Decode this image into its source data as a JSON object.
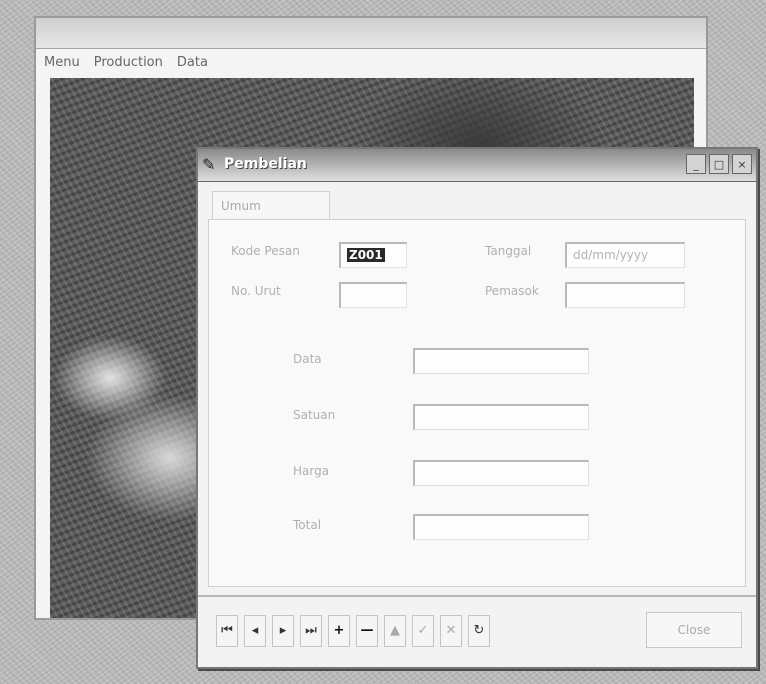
{
  "main_window": {
    "title": "",
    "menu": [
      "Menu",
      "Production",
      "Data"
    ]
  },
  "dialog": {
    "title": "Pembelian",
    "tab_label": "Umum"
  },
  "fields": {
    "row1": {
      "label_left": "Kode Pesan",
      "value_left": "Z001",
      "label_right": "Tanggal",
      "value_right": "dd/mm/yyyy"
    },
    "row2": {
      "label_left": "No. Urut",
      "value_left": "",
      "label_right": "Pemasok",
      "value_right": ""
    },
    "data_label": "Data",
    "data_value": "",
    "satuan_label": "Satuan",
    "satuan_value": "",
    "harga_label": "Harga",
    "harga_value": "",
    "total_label": "Total",
    "total_value": ""
  },
  "toolbar": {
    "first": "⏮",
    "prev": "◂",
    "next": "▸",
    "last": "⏭",
    "add": "+",
    "delete": "—",
    "edit": "▲",
    "post": "✓",
    "cancel": "✕",
    "refresh": "↻",
    "close_label": "Close"
  },
  "win_buttons": {
    "minimize": "_",
    "maximize": "□",
    "close": "×"
  }
}
